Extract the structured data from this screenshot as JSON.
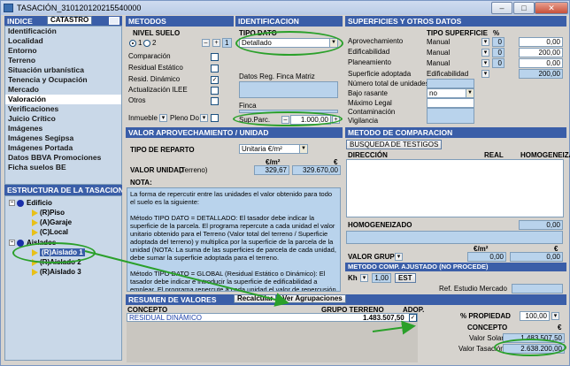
{
  "window": {
    "title": "TASACIÓN_310120120215540000"
  },
  "left": {
    "header_indice": "INDICE",
    "header_catastro": "CATASTRO",
    "items": [
      {
        "label": "Identificación"
      },
      {
        "label": "Localidad"
      },
      {
        "label": "Entorno"
      },
      {
        "label": "Terreno"
      },
      {
        "label": "Situación urbanística"
      },
      {
        "label": "Tenencia y Ocupación"
      },
      {
        "label": "Mercado"
      },
      {
        "label": "Valoración"
      },
      {
        "label": "Verificaciones"
      },
      {
        "label": "Juicio Crítico"
      },
      {
        "label": "Imágenes"
      },
      {
        "label": "Imágenes Segipsa"
      },
      {
        "label": "Imágenes Portada"
      },
      {
        "label": "Datos BBVA Promociones"
      },
      {
        "label": "Ficha suelos BE"
      }
    ],
    "selected": "Valoración",
    "tree_header": "ESTRUCTURA DE LA TASACION",
    "tree": {
      "root1": "Edificio",
      "root1_children": [
        "(R)Piso",
        "(A)Garaje",
        "(C)Local"
      ],
      "root2": "Aislados",
      "root2_children": [
        "(R)Aislado 1",
        "(R)Aislado 2",
        "(R)Aislado 3"
      ]
    }
  },
  "metodos": {
    "header": "METODOS",
    "nivel_suelo": "NIVEL SUELO",
    "radio1": "1",
    "radio2": "2",
    "nivel_value": "1",
    "items": [
      "Comparación",
      "Residual Estático",
      "Resid. Dinámico",
      "Actualización ILEE",
      "Otros"
    ],
    "inmueble": "Inmueble",
    "pleno_dominio": "Pleno Do"
  },
  "identificacion": {
    "header": "IDENTIFICACION",
    "tipo_dato_label": "TIPO DATO",
    "tipo_dato_value": "Detallado",
    "datos_reg_label": "Datos Reg. Finca Matriz",
    "finca_label": "Finca",
    "sup_parc_label": "Sup.Parc.",
    "sup_parc_value": "1.000,00"
  },
  "superficies": {
    "header": "SUPERFICIES Y OTROS DATOS",
    "tipo_superficie": "TIPO SUPERFICIE",
    "pct_header": "%",
    "rows": [
      {
        "label": "Aprovechamiento",
        "tipo": "Manual",
        "pct": "0",
        "value": "0,00"
      },
      {
        "label": "Edificabilidad",
        "tipo": "Manual",
        "pct": "0",
        "value": "200,00"
      },
      {
        "label": "Planeamiento",
        "tipo": "Manual",
        "pct": "0",
        "value": "0,00"
      }
    ],
    "sup_adoptada_label": "Superficie adoptada",
    "sup_adoptada_tipo": "Edificabilidad",
    "sup_adoptada_value": "200,00",
    "num_unidades": "Número total de unidades",
    "bajo_rasante": "Bajo rasante",
    "bajo_rasante_value": "no",
    "maximo_legal": "Máximo Legal",
    "contaminacion": "Contaminación",
    "vigilancia": "Vigilancia"
  },
  "valor_aprov": {
    "header": "VALOR APROVECHAMIENTO / UNIDAD",
    "tipo_reparto_label": "TIPO DE REPARTO",
    "tipo_reparto_value": "Unitaria €/m²",
    "col_eur_m2": "€/m²",
    "col_eur": "€",
    "valor_unidad_label": "VALOR UNIDAD",
    "terreno_label": "(Terreno)",
    "valor_m2": "329,67",
    "valor_total": "329.670,00",
    "nota_label": "NOTA:",
    "nota_paragraphs": [
      "La forma de repercutir entre las unidades el valor obtenido para todo el suelo es la siguiente:",
      "Método TIPO DATO = DETALLADO: El tasador debe indicar la superficie de la parcela. El programa repercute a cada unidad el valor unitario obtenido para el Terreno (Valor total del terreno / Superficie adoptada del terreno) y multiplica por la superficie de la parcela de la unidad (NOTA: La suma de las superficies de parcela de cada unidad, debe sumar la superficie adoptada para el terreno.",
      "Método TIPO DATO = GLOBAL (Residual Estático o Dinámico): El tasador debe indicar e introducir la superficie de edificabilidad a emplear. El programa repercute a cada unidad el valor de repercusión obtenido por el"
    ]
  },
  "metodo_comparacion": {
    "header": "METODO DE COMPARACION",
    "busqueda": "BUSQUEDA DE TESTIGOS",
    "col_direccion": "DIRECCIÓN",
    "col_real": "REAL",
    "col_homogeneiza": "HOMOGENEIZA",
    "homogeneizado_label": "HOMOGENEIZADO",
    "homogeneizado_value": "0,00",
    "col_eur_m2": "€/m²",
    "col_eur": "€",
    "valor_grupo_label": "VALOR GRUPO",
    "valor_grupo_m2": "0,00",
    "valor_grupo_total": "0,00"
  },
  "metodo_ajustado": {
    "header": "METODO COMP. AJUSTADO (NO PROCEDE)",
    "kh_label": "Kh",
    "kh_value": "1,00",
    "est_button": "EST",
    "ref_label": "Ref. Estudio Mercado"
  },
  "resumen": {
    "header": "RESUMEN DE VALORES",
    "recalcular": "Recalcular",
    "ver_agrupaciones": "Ver Agrupaciones",
    "col_concepto": "CONCEPTO",
    "col_grupo_terreno": "GRUPO TERRENO",
    "col_adop": "ADOP.",
    "row_concepto": "RESIDUAL DINÁMICO",
    "row_value": "1.483.507,50",
    "propiedad_label": "% PROPIEDAD",
    "propiedad_value": "100,00",
    "concepto_label": "CONCEPTO",
    "concepto_value": "€",
    "valor_solar_label": "Valor Solar",
    "valor_solar_value": "1.483.507,50",
    "valor_tasacion_label": "Valor Tasación",
    "valor_tasacion_value": "2.638.200,00"
  },
  "colors": {
    "header_blue": "#3a5ea8",
    "nav_bg": "#c9d8e8",
    "field_blue": "#b9d3ec",
    "highlight_green": "#2aa02a"
  }
}
